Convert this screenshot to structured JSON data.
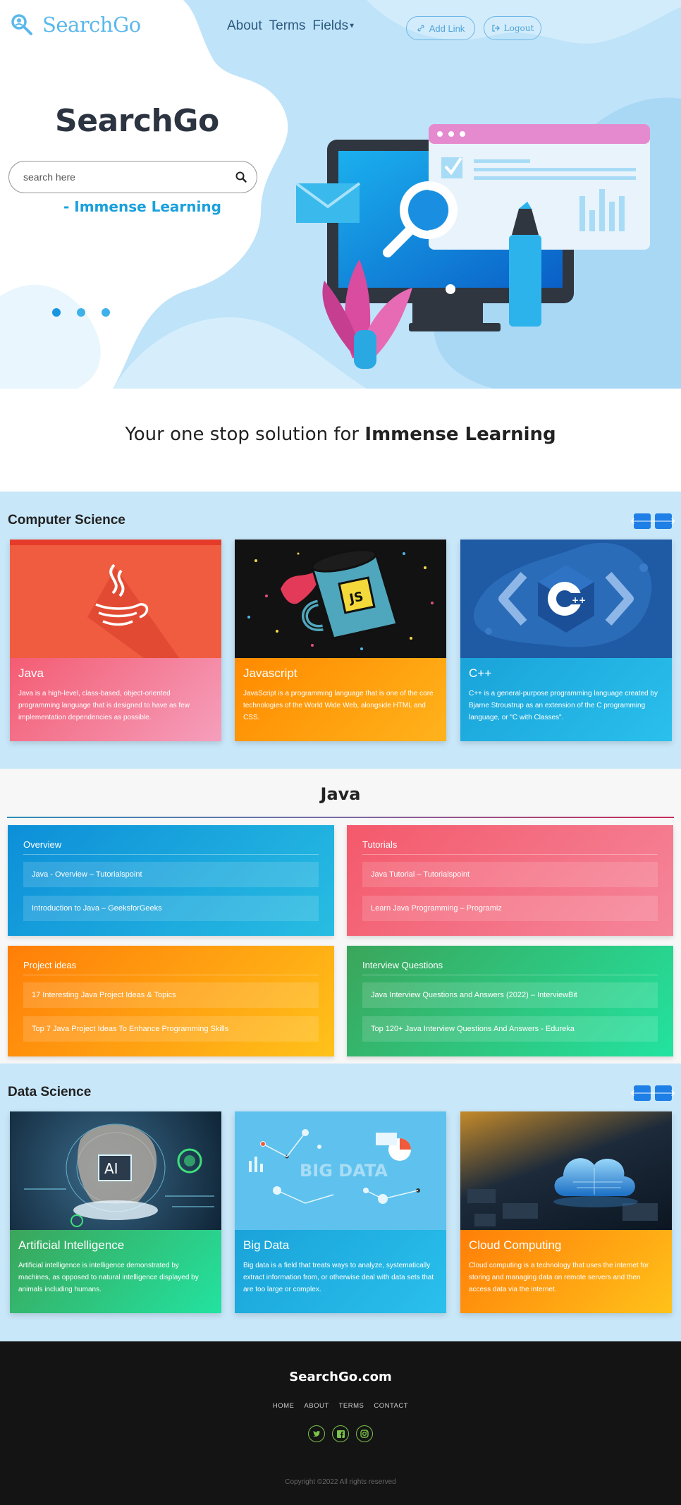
{
  "colors": {
    "hero_blob": "#bfe3f9",
    "accent_blue": "#1e7fe6",
    "section_bg": "#c8e7f9",
    "footer_bg": "#141414",
    "social_border": "#7cc24a"
  },
  "nav": {
    "brand": "SearchGo",
    "brand_icon": "magnifier-icon",
    "links": [
      "About",
      "Terms",
      "Fields"
    ],
    "add_link_label": "Add Link",
    "add_link_icon": "link-icon",
    "logout_label": "Logout",
    "logout_icon": "logout-icon"
  },
  "hero": {
    "title": "SearchGo",
    "search_placeholder": "search here",
    "search_icon": "search-icon",
    "tagline": "- Immense Learning",
    "carousel_dots": 3,
    "active_dot": 0
  },
  "slogan": {
    "prefix": "Your one stop solution for ",
    "emphasis": "Immense Learning"
  },
  "computer_science": {
    "title": "Computer Science",
    "cards": [
      {
        "title": "Java",
        "text": "Java is a high-level, class-based, object-oriented programming language that is designed to have as few implementation dependencies as possible.",
        "image": "java-logo-icon"
      },
      {
        "title": "Javascript",
        "text": "JavaScript is a programming language that is one of the core technologies of the World Wide Web, alongside HTML and CSS.",
        "image": "js-mug-icon"
      },
      {
        "title": "C++",
        "text": "C++ is a general-purpose programming language created by Bjarne Stroustrup as an extension of the C programming language, or \"C with Classes\".",
        "image": "cpp-logo-icon"
      }
    ]
  },
  "java_section": {
    "title": "Java",
    "groups": [
      {
        "heading": "Overview",
        "links": [
          "Java - Overview – Tutorialspoint",
          "Introduction to Java – GeeksforGeeks"
        ]
      },
      {
        "heading": "Tutorials",
        "links": [
          "Java Tutorial – Tutorialspoint",
          "Learn Java Programming – Programiz"
        ]
      },
      {
        "heading": "Project ideas",
        "links": [
          "17 Interesting Java Project Ideas & Topics",
          "Top 7 Java Project Ideas To Enhance Programming Skills"
        ]
      },
      {
        "heading": "Interview Questions",
        "links": [
          "Java Interview Questions and Answers (2022) – InterviewBit",
          "Top 120+ Java Interview Questions And Answers - Edureka"
        ]
      }
    ]
  },
  "data_science": {
    "title": "Data Science",
    "cards": [
      {
        "title": "Artificial Intelligence",
        "text": "Artificial intelligence is intelligence demonstrated by machines, as opposed to natural intelligence displayed by animals including humans.",
        "image": "ai-head-icon",
        "image_label": "AI"
      },
      {
        "title": "Big Data",
        "text": "Big data is a field that treats ways to analyze, systematically extract information from, or otherwise deal with data sets that are too large or complex.",
        "image": "big-data-icon",
        "image_label": "BIG DATA"
      },
      {
        "title": "Cloud Computing",
        "text": "Cloud computing is a technology that uses the internet for storing and managing data on remote servers and then access data via the internet.",
        "image": "cloud-chip-icon"
      }
    ]
  },
  "footer": {
    "brand": "SearchGo.com",
    "links": [
      "HOME",
      "ABOUT",
      "TERMS",
      "CONTACT"
    ],
    "socials": [
      "twitter-icon",
      "facebook-icon",
      "instagram-icon"
    ],
    "copyright": "Copyright ©2022 All rights reserved"
  }
}
